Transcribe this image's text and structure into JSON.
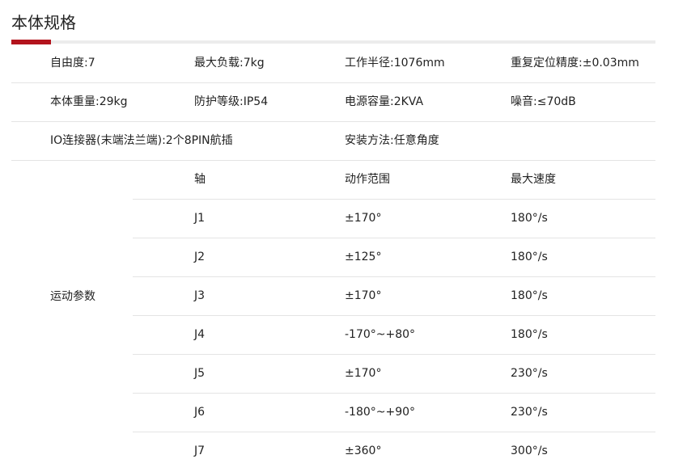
{
  "section": {
    "title": "本体规格"
  },
  "specs": [
    [
      "自由度:7",
      "最大负载:7kg",
      "工作半径:1076mm",
      "重复定位精度:±0.03mm"
    ],
    [
      "本体重量:29kg",
      "防护等级:IP54",
      "电源容量:2KVA",
      "噪音:≤70dB"
    ]
  ],
  "io_connector": "IO连接器(末端法兰端):2个8PIN航插",
  "install_method": "安装方法:任意角度",
  "motion": {
    "label": "运动参数",
    "headers": [
      "轴",
      "动作范围",
      "最大速度"
    ],
    "rows": [
      [
        "J1",
        "±170°",
        "180°/s"
      ],
      [
        "J2",
        "±125°",
        "180°/s"
      ],
      [
        "J3",
        "±170°",
        "180°/s"
      ],
      [
        "J4",
        "-170°~+80°",
        "180°/s"
      ],
      [
        "J5",
        "±170°",
        "230°/s"
      ],
      [
        "J6",
        "-180°~+90°",
        "230°/s"
      ],
      [
        "J7",
        "±360°",
        "300°/s"
      ]
    ]
  },
  "colors": {
    "accent": "#b3141d",
    "divider": "#e4e4e4",
    "text": "#222222"
  }
}
